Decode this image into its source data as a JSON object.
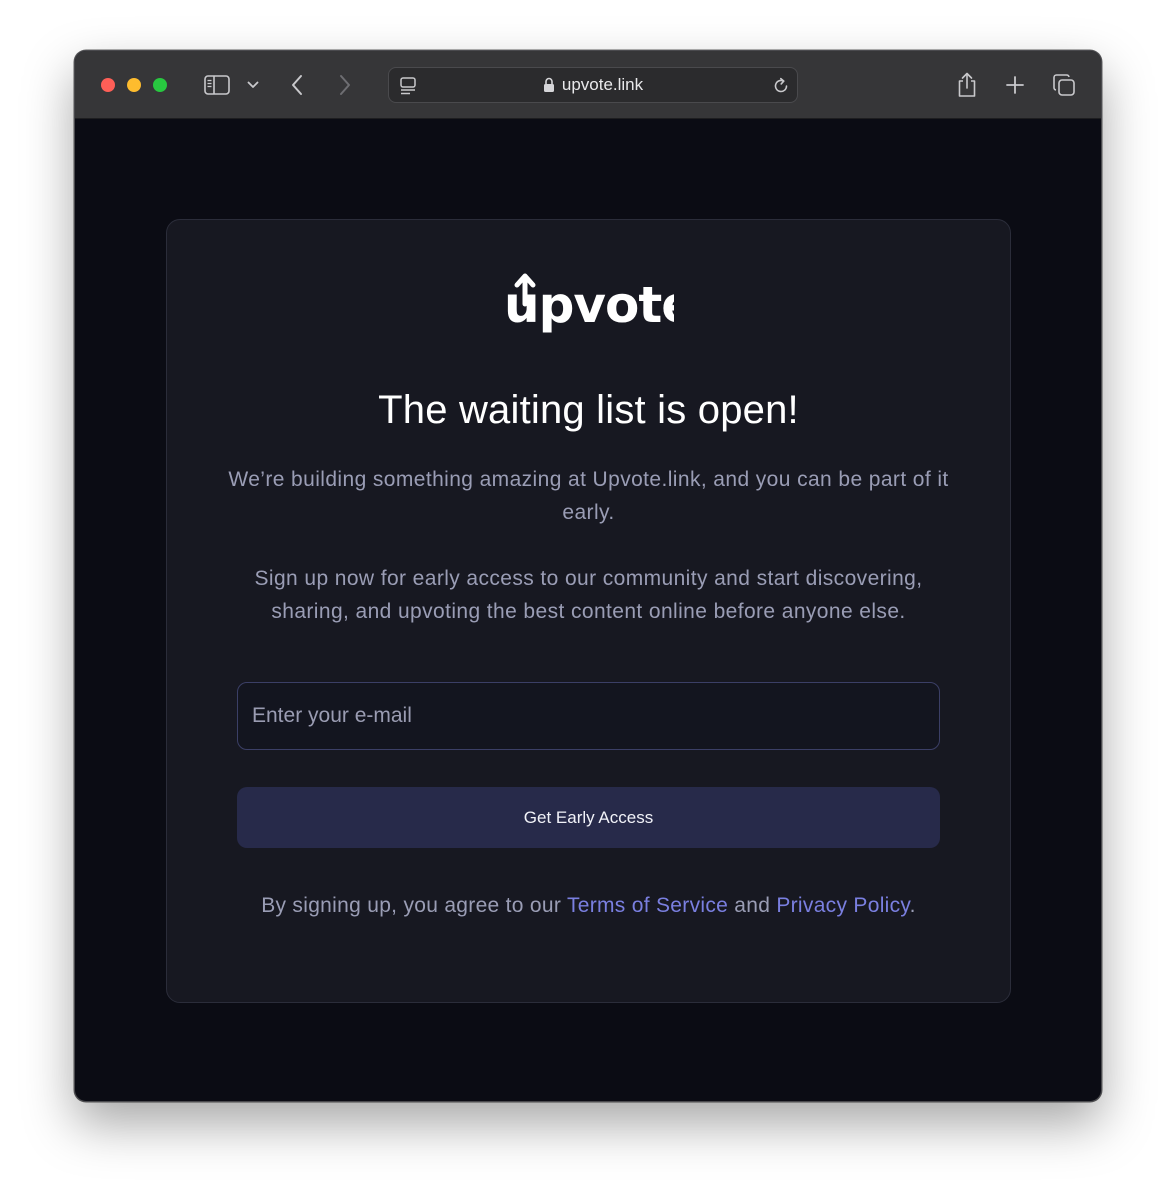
{
  "browser": {
    "url": "upvote.link",
    "colors": {
      "toolbar": "#363638",
      "close": "#fe5f57",
      "minimize": "#febc2e",
      "maximize": "#28c840"
    },
    "icons": [
      "sidebar-icon",
      "chevron-down-icon",
      "back-icon",
      "forward-icon",
      "page-menu-icon",
      "lock-icon",
      "reload-icon",
      "share-icon",
      "plus-icon",
      "tabs-icon"
    ]
  },
  "page": {
    "logo_text": "upvote",
    "headline": "The waiting list is open!",
    "paragraph_1": "We’re building something amazing at Upvote.link, and you can be part of it early.",
    "paragraph_2": "Sign up now for early access to our community and start discovering, sharing, and upvoting the best content online before anyone else.",
    "email_placeholder": "Enter your e-mail",
    "email_value": "",
    "cta_label": "Get Early Access",
    "legal": {
      "prefix": "By signing up, you agree to our ",
      "terms_label": "Terms of Service",
      "middle": " and ",
      "privacy_label": "Privacy Policy",
      "suffix": "."
    },
    "colors": {
      "background": "#0b0c14",
      "card": "#171821",
      "button": "#272a4a",
      "link": "#7a7fe0",
      "muted_text": "#9a9db5"
    }
  }
}
